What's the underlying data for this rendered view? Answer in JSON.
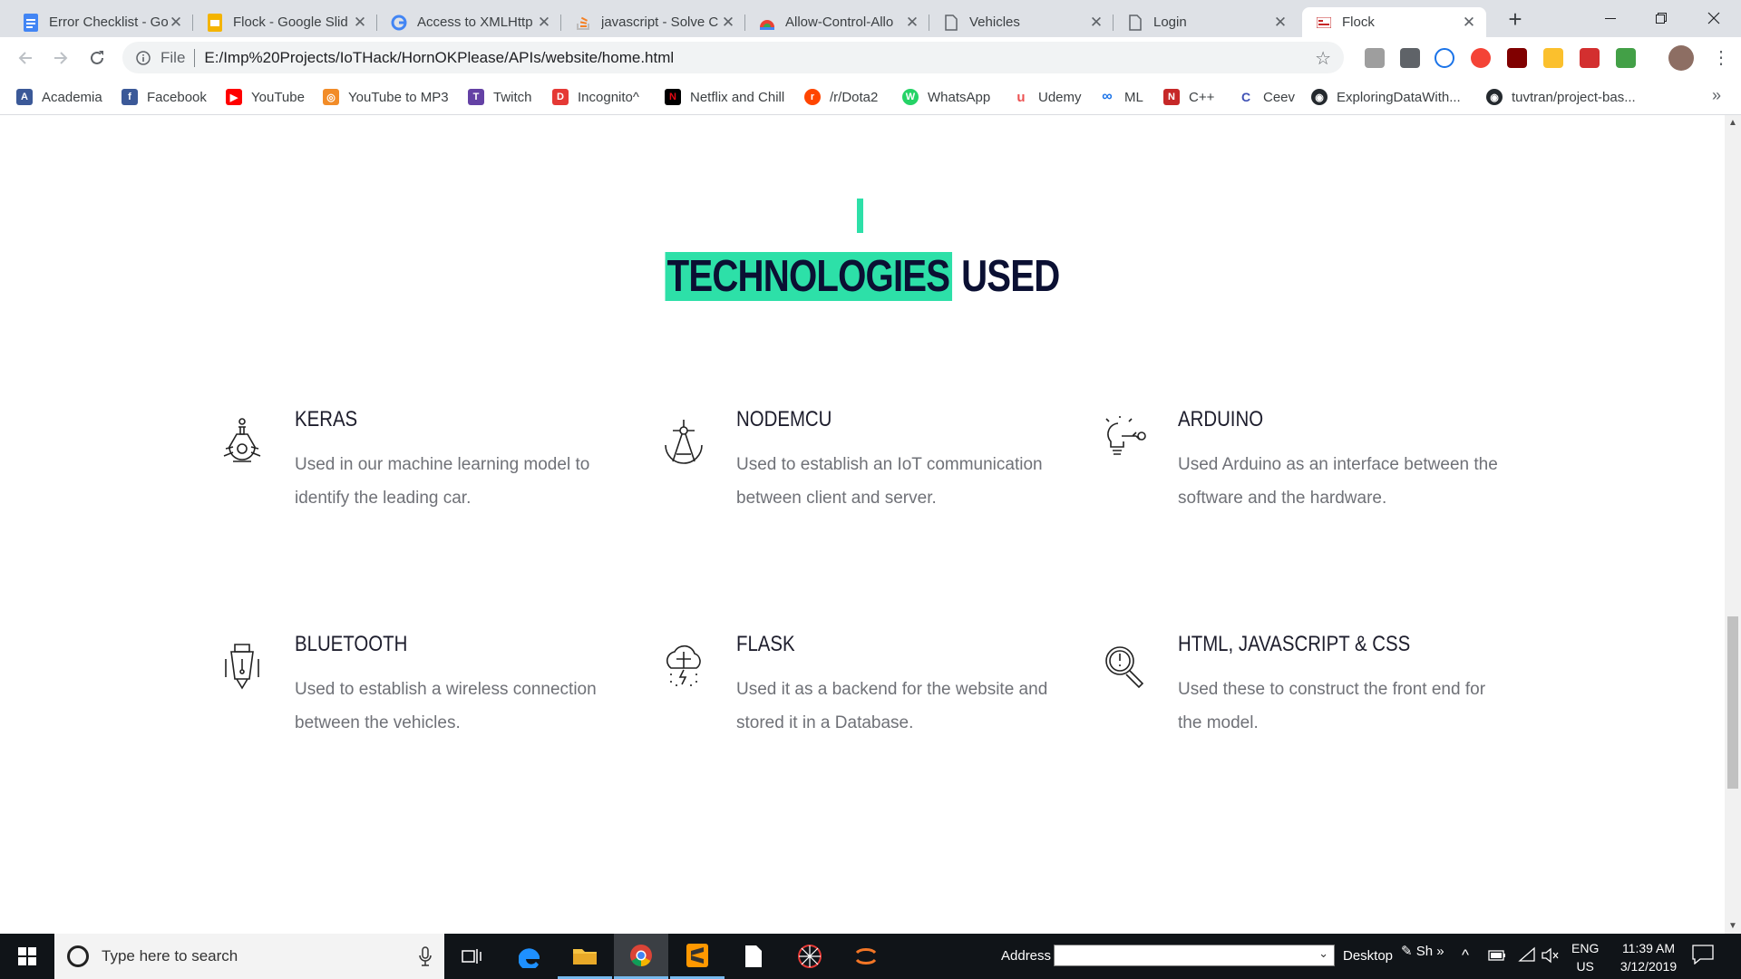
{
  "browser": {
    "tabs": [
      {
        "title": "Error Checklist - Go",
        "favicon_color": "#4285f4",
        "favicon": "docs-icon"
      },
      {
        "title": "Flock - Google Slid",
        "favicon_color": "#f4b400",
        "favicon": "slides-icon"
      },
      {
        "title": "Access to XMLHttp",
        "favicon_color": "#4285f4",
        "favicon": "google-icon"
      },
      {
        "title": "javascript - Solve C",
        "favicon_color": "#f48024",
        "favicon": "stackoverflow-icon"
      },
      {
        "title": "Allow-Control-Allo",
        "favicon_color": "#e94235",
        "favicon": "chrome-store-icon"
      },
      {
        "title": "Vehicles",
        "favicon_color": "#5f6368",
        "favicon": "page-icon"
      },
      {
        "title": "Login",
        "favicon_color": "#5f6368",
        "favicon": "page-icon"
      },
      {
        "title": "Flock",
        "favicon_color": "#c62828",
        "favicon": "flock-icon",
        "active": true
      }
    ],
    "address": {
      "scheme_label": "File",
      "url": "E:/Imp%20Projects/IoTHack/HornOKPlease/APIs/website/home.html"
    },
    "bookmarks": [
      {
        "label": "Academia",
        "color": "#3b5998",
        "glyph": "A"
      },
      {
        "label": "Facebook",
        "color": "#3b5998",
        "glyph": "f"
      },
      {
        "label": "YouTube",
        "color": "#ff0000",
        "glyph": "▶"
      },
      {
        "label": "YouTube to MP3",
        "color": "#f28c28",
        "glyph": "◎"
      },
      {
        "label": "Twitch",
        "color": "#6441a5",
        "glyph": "T"
      },
      {
        "label": "Incognito^",
        "color": "#e53935",
        "glyph": "D"
      },
      {
        "label": "Netflix and Chill",
        "color": "#e50914",
        "glyph": "N"
      },
      {
        "label": "/r/Dota2",
        "color": "#ff4500",
        "glyph": "r"
      },
      {
        "label": "WhatsApp",
        "color": "#25d366",
        "glyph": "W"
      },
      {
        "label": "Udemy",
        "color": "#ec5252",
        "glyph": "u"
      },
      {
        "label": "ML",
        "color": "#1a73e8",
        "glyph": "∞"
      },
      {
        "label": "C++",
        "color": "#c62828",
        "glyph": "N"
      },
      {
        "label": "Ceev",
        "color": "#3f51b5",
        "glyph": "C"
      },
      {
        "label": "ExploringDataWith...",
        "color": "#24292e",
        "glyph": "◉"
      },
      {
        "label": "tuvtran/project-bas...",
        "color": "#24292e",
        "glyph": "◉"
      }
    ]
  },
  "page": {
    "section_title_highlight": "TECHNOLOGIES",
    "section_title_rest": "USED",
    "accent_color": "#2de0a8",
    "technologies": [
      {
        "name": "KERAS",
        "description": "Used in our machine learning model to identify the leading car.",
        "icon": "flask-brain-icon"
      },
      {
        "name": "NODEMCU",
        "description": "Used to establish an IoT communication between client and server.",
        "icon": "compass-icon"
      },
      {
        "name": "ARDUINO",
        "description": "Used Arduino as an interface between the software and the hardware.",
        "icon": "lightbulb-key-icon"
      },
      {
        "name": "BLUETOOTH",
        "description": "Used to establish a wireless connection between the vehicles.",
        "icon": "pen-nib-icon"
      },
      {
        "name": "FLASK",
        "description": "Used it as a backend for the website and stored it in a Database.",
        "icon": "brain-cloud-icon"
      },
      {
        "name": "HTML, JAVASCRIPT & CSS",
        "description": "Used these to construct the front end for the model.",
        "icon": "magnifier-icon"
      }
    ]
  },
  "taskbar": {
    "search_placeholder": "Type here to search",
    "address_label": "Address",
    "desktop_label": "Desktop",
    "lang_short": "Sh",
    "lang_line1": "ENG",
    "lang_line2": "US",
    "time": "11:39 AM",
    "date": "3/12/2019"
  }
}
